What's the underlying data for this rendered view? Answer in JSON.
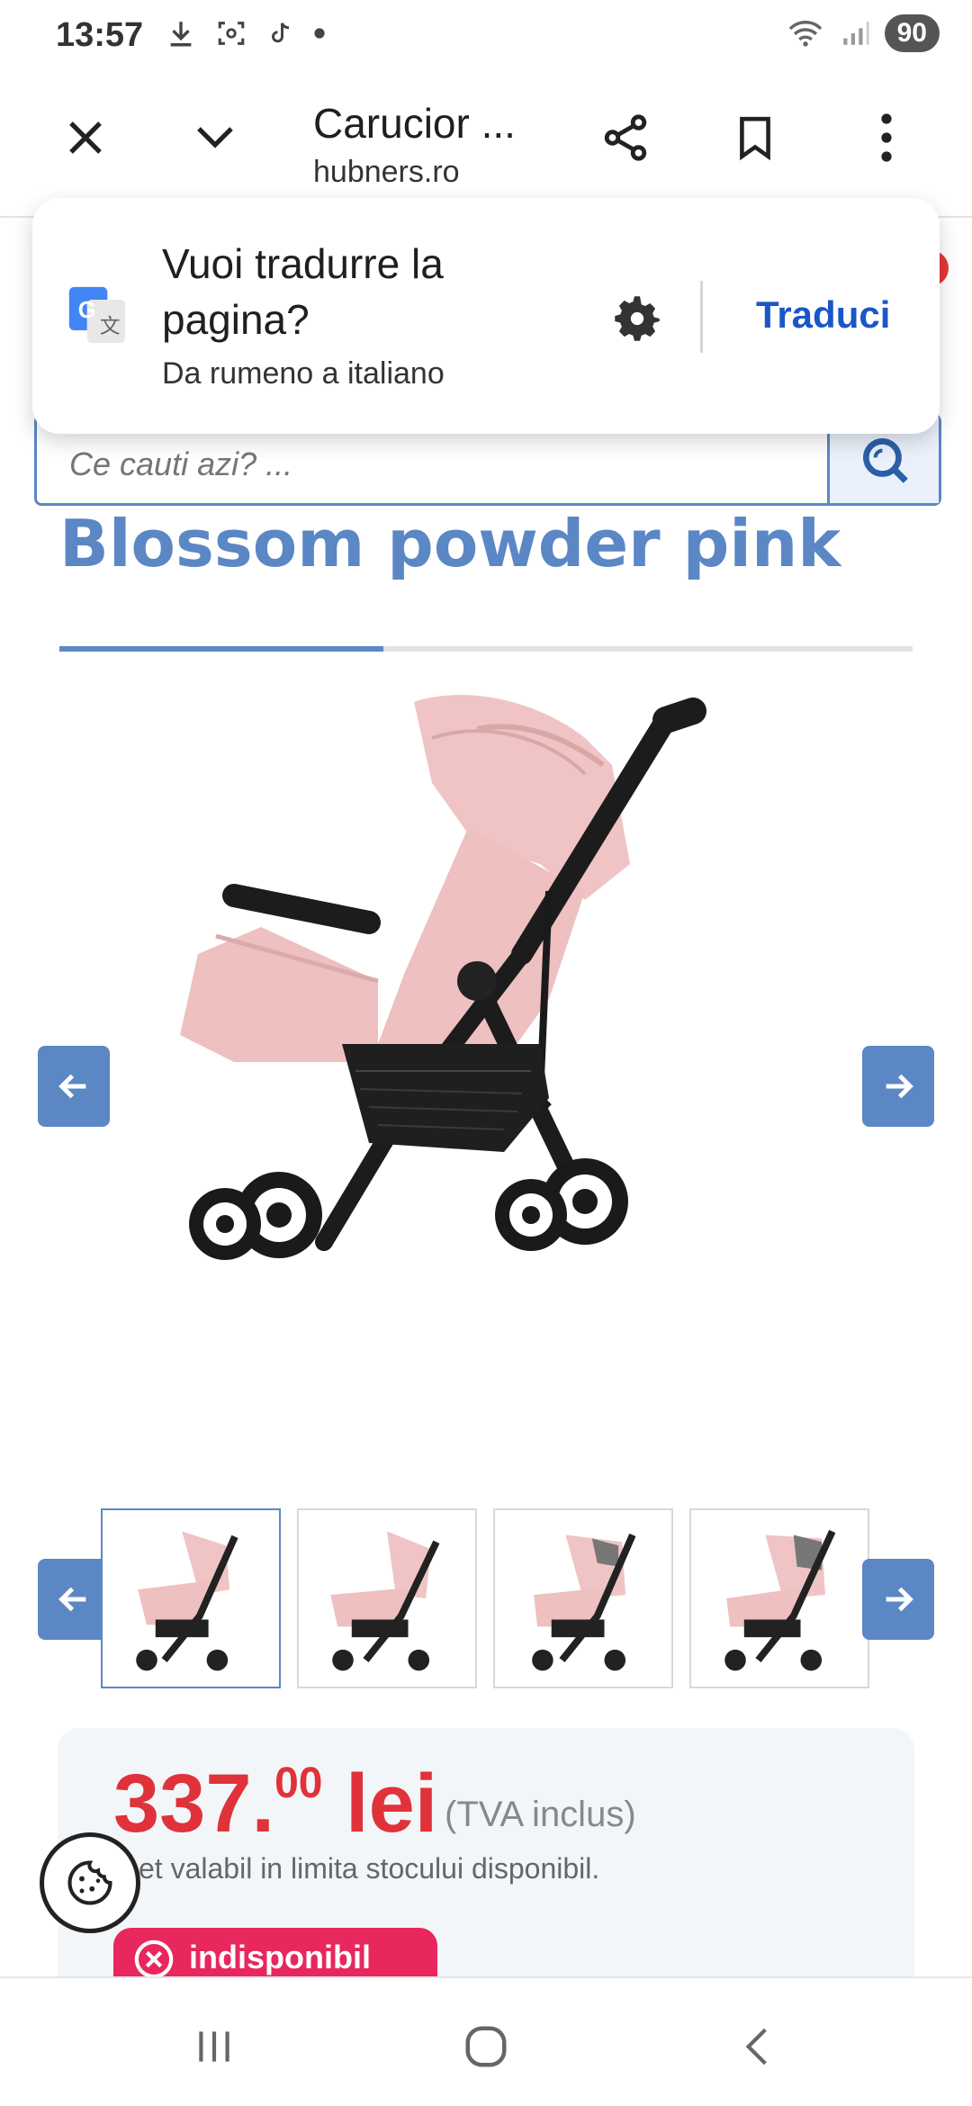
{
  "status_bar": {
    "time": "13:57",
    "icons": [
      "download-icon",
      "screenshot-icon",
      "tiktok-icon",
      "dot-icon"
    ],
    "battery": "90"
  },
  "toolbar": {
    "title": "Carucior ...",
    "domain": "hubners.ro"
  },
  "translate_prompt": {
    "title": "Vuoi tradurre la pagina?",
    "subtitle": "Da rumeno a italiano",
    "action_label": "Traduci"
  },
  "search": {
    "placeholder": "Ce cauti azi? ..."
  },
  "product": {
    "title": "Blossom powder pink",
    "price_int": "337.",
    "price_dec": "00",
    "currency": "lei",
    "tva": "(TVA inclus)",
    "stock_note": "et valabil in limita stocului disponibil.",
    "availability": "indisponibil",
    "gallery_progress": 0.38,
    "thumbnails_count": 4
  },
  "colors": {
    "brand_blue": "#5b87c5",
    "price_red": "#e0323a",
    "badge_pink": "#e8275d",
    "translate_blue": "#1a56c8"
  }
}
